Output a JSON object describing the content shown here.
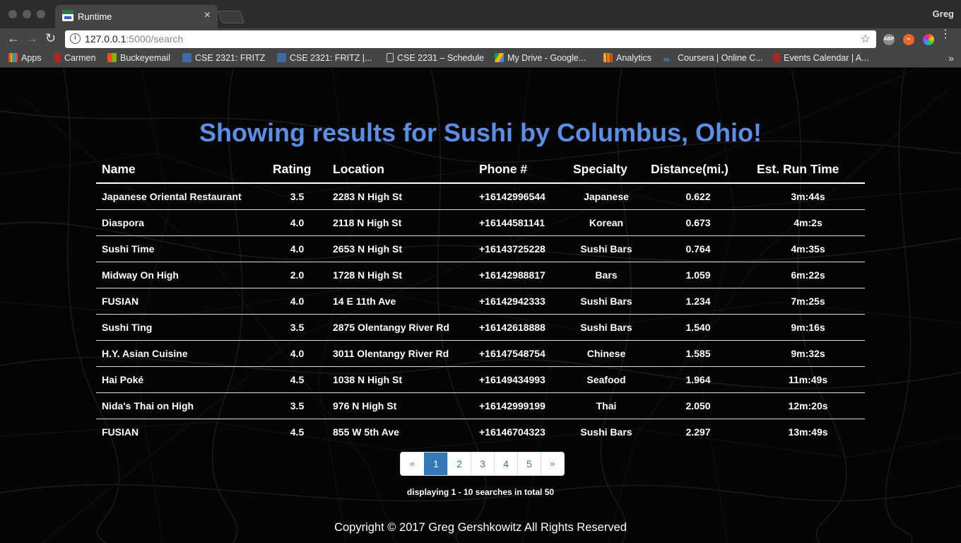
{
  "browser": {
    "tab_title": "Runtime",
    "tab_close": "×",
    "profile_name": "Greg",
    "url_host": "127.0.0.1",
    "url_path": ":5000/search",
    "bookmarks": [
      {
        "label": "Apps",
        "icon": "apps-grid-icon",
        "color": "#e84a3a"
      },
      {
        "label": "Carmen",
        "icon": "carmen-icon",
        "color": "#b7221d"
      },
      {
        "label": "Buckeyemail",
        "icon": "outlook-icon",
        "color": "#2a7ad6"
      },
      {
        "label": "CSE 2321: FRITZ",
        "icon": "piazza-icon",
        "color": "#3f6aa8"
      },
      {
        "label": "CSE 2321: FRITZ |...",
        "icon": "piazza-icon",
        "color": "#3f6aa8"
      },
      {
        "label": "CSE 2231 – Schedule",
        "icon": "document-icon",
        "color": "#e6e6e6"
      },
      {
        "label": "My Drive - Google...",
        "icon": "google-drive-icon",
        "color": "#f2b21a"
      },
      {
        "label": "Analytics",
        "icon": "analytics-icon",
        "color": "#f5a623"
      },
      {
        "label": "Coursera | Online C...",
        "icon": "coursera-icon",
        "color": "#2a73cc"
      },
      {
        "label": "Events Calendar | A...",
        "icon": "calendar-icon",
        "color": "#b7221d"
      }
    ],
    "more_bookmarks": "»"
  },
  "page": {
    "heading": "Showing results for Sushi by Columbus, Ohio!",
    "columns": [
      "Name",
      "Rating",
      "Location",
      "Phone #",
      "Specialty",
      "Distance(mi.)",
      "Est. Run Time"
    ],
    "rows": [
      [
        "Japanese Oriental Restaurant",
        "3.5",
        "2283 N High St",
        "+16142996544",
        "Japanese",
        "0.622",
        "3m:44s"
      ],
      [
        "Diaspora",
        "4.0",
        "2118 N High St",
        "+16144581141",
        "Korean",
        "0.673",
        "4m:2s"
      ],
      [
        "Sushi Time",
        "4.0",
        "2653 N High St",
        "+16143725228",
        "Sushi Bars",
        "0.764",
        "4m:35s"
      ],
      [
        "Midway On High",
        "2.0",
        "1728 N High St",
        "+16142988817",
        "Bars",
        "1.059",
        "6m:22s"
      ],
      [
        "FUSIAN",
        "4.0",
        "14 E 11th Ave",
        "+16142942333",
        "Sushi Bars",
        "1.234",
        "7m:25s"
      ],
      [
        "Sushi Ting",
        "3.5",
        "2875 Olentangy River Rd",
        "+16142618888",
        "Sushi Bars",
        "1.540",
        "9m:16s"
      ],
      [
        "H.Y. Asian Cuisine",
        "4.0",
        "3011 Olentangy River Rd",
        "+16147548754",
        "Chinese",
        "1.585",
        "9m:32s"
      ],
      [
        "Hai Poké",
        "4.5",
        "1038 N High St",
        "+16149434993",
        "Seafood",
        "1.964",
        "11m:49s"
      ],
      [
        "Nida's Thai on High",
        "3.5",
        "976 N High St",
        "+16142999199",
        "Thai",
        "2.050",
        "12m:20s"
      ],
      [
        "FUSIAN",
        "4.5",
        "855 W 5th Ave",
        "+16146704323",
        "Sushi Bars",
        "2.297",
        "13m:49s"
      ]
    ],
    "pagination": {
      "prev": "«",
      "pages": [
        "1",
        "2",
        "3",
        "4",
        "5"
      ],
      "active_page": "1",
      "next": "»"
    },
    "displaying": {
      "prefix": "displaying",
      "range": "1 - 10",
      "middle": "searches in total",
      "total": "50"
    },
    "copyright": "Copyright © 2017 Greg Gershkowitz All Rights Reserved"
  }
}
